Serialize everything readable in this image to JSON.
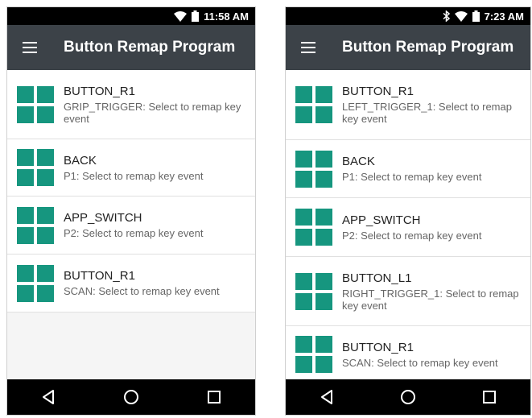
{
  "left": {
    "status": {
      "time": "11:58 AM"
    },
    "appbar": {
      "title": "Button Remap Program"
    },
    "items": [
      {
        "title": "BUTTON_R1",
        "subtitle": "GRIP_TRIGGER: Select to remap key event"
      },
      {
        "title": "BACK",
        "subtitle": "P1: Select to remap key event"
      },
      {
        "title": "APP_SWITCH",
        "subtitle": "P2: Select to remap key event"
      },
      {
        "title": "BUTTON_R1",
        "subtitle": "SCAN: Select to remap key event"
      }
    ]
  },
  "right": {
    "status": {
      "time": "7:23 AM"
    },
    "appbar": {
      "title": "Button Remap Program"
    },
    "items": [
      {
        "title": "BUTTON_R1",
        "subtitle": "LEFT_TRIGGER_1: Select to remap key event"
      },
      {
        "title": "BACK",
        "subtitle": "P1: Select to remap key event"
      },
      {
        "title": "APP_SWITCH",
        "subtitle": "P2: Select to remap key event"
      },
      {
        "title": "BUTTON_L1",
        "subtitle": "RIGHT_TRIGGER_1: Select to remap key event"
      },
      {
        "title": "BUTTON_R1",
        "subtitle": "SCAN: Select to remap key event"
      }
    ]
  },
  "theme": {
    "appbar_color": "#3c4248",
    "icon_color": "#16967f",
    "nav_color": "#000000"
  },
  "icons": {
    "menu": "hamburger-icon",
    "item": "grid-icon",
    "back": "back-triangle-icon",
    "home": "home-circle-icon",
    "recents": "recents-square-icon"
  }
}
